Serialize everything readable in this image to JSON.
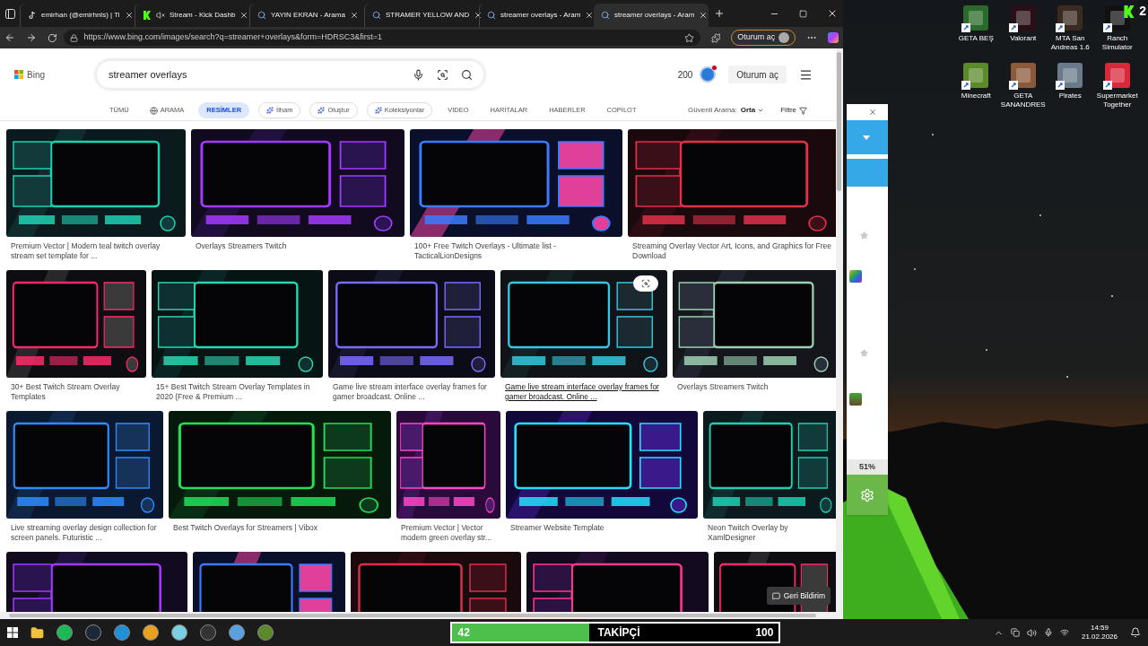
{
  "browser": {
    "tabs": [
      {
        "title": "emirhan (@emirhnls) | Ti",
        "kind": "note",
        "muted": false,
        "selected": false
      },
      {
        "title": "Stream - Kick Dashb",
        "kind": "k",
        "muted": true,
        "selected": false
      },
      {
        "title": "YAYIN EKRAN - Arama",
        "kind": "search",
        "muted": false,
        "selected": false
      },
      {
        "title": "STRAMER YELLOW AND",
        "kind": "search",
        "muted": false,
        "selected": false
      },
      {
        "title": "streamer overlays - Aram",
        "kind": "search",
        "muted": false,
        "selected": false
      },
      {
        "title": "streamer overlays - Aram",
        "kind": "search",
        "muted": false,
        "selected": true
      }
    ],
    "address": "https://www.bing.com/images/search?q=streamer+overlays&form=HDRSC3&first=1",
    "profile_button": "Oturum aç"
  },
  "bing": {
    "logo": "Bing",
    "query": "streamer overlays",
    "points": "200",
    "sign_in": "Oturum aç",
    "nav": [
      {
        "label": "TÜMÜ",
        "kind": "text",
        "selected": false
      },
      {
        "label": "ARAMA",
        "kind": "icon",
        "selected": false
      },
      {
        "label": "RESİMLER",
        "kind": "text",
        "selected": true
      },
      {
        "label": "İlham",
        "kind": "chip",
        "selected": false
      },
      {
        "label": "Oluştur",
        "kind": "chip",
        "selected": false
      },
      {
        "label": "Koleksiyonlar",
        "kind": "chip",
        "selected": false
      },
      {
        "label": "VİDEO",
        "kind": "text",
        "selected": false
      },
      {
        "label": "HARİTALAR",
        "kind": "text",
        "selected": false
      },
      {
        "label": "HABERLER",
        "kind": "text",
        "selected": false
      },
      {
        "label": "COPİLOT",
        "kind": "text",
        "selected": false
      }
    ],
    "safe_search_label": "Güvenli Arama:",
    "safe_search_value": "Orta",
    "filter": "Filtre",
    "rows": [
      [
        {
          "caption": "Premium Vector | Modern teal twitch overlay stream set template for ...",
          "hovered": false
        },
        {
          "caption": "Overlays Streamers Twitch",
          "hovered": false
        },
        {
          "caption": "100+ Free Twitch Overlays - Ultimate list - TacticalLionDesigns",
          "hovered": false
        },
        {
          "caption": "Streaming Overlay Vector Art, Icons, and Graphics for Free Download",
          "hovered": false
        }
      ],
      [
        {
          "caption": "30+ Best Twitch Stream Overlay Templates",
          "hovered": false
        },
        {
          "caption": "15+ Best Twitch Stream Overlay Templates in 2020 (Free & Premium ...",
          "hovered": false
        },
        {
          "caption": "Game live stream interface overlay frames for gamer broadcast. Online ...",
          "hovered": false
        },
        {
          "caption": "Game live stream interface overlay frames for gamer broadcast. Online ...",
          "hovered": true
        },
        {
          "caption": "Overlays Streamers Twitch",
          "hovered": false
        }
      ],
      [
        {
          "caption": "Live streaming overlay design collection for screen panels. Futuristic ...",
          "hovered": false
        },
        {
          "caption": "Best Twitch Overlays for Streamers | Vibox",
          "hovered": false
        },
        {
          "caption": "Premium Vector | Vector modern green overlay str...",
          "hovered": false
        },
        {
          "caption": "Streamer Website Template",
          "hovered": false
        },
        {
          "caption": "Neon Twitch Overlay by XamlDesigner",
          "hovered": false
        }
      ],
      [
        {
          "hovered": false
        },
        {
          "hovered": false
        },
        {
          "hovered": false
        },
        {
          "hovered": false
        },
        {
          "hovered": false
        }
      ]
    ],
    "feedback": "Geri Bildirim"
  },
  "desktop": {
    "corner_badge": "2",
    "icons": [
      {
        "label": "GETA BEŞ"
      },
      {
        "label": "Valorant"
      },
      {
        "label": "MTA San Andreas 1.6"
      },
      {
        "label": "Ranch Simulator"
      },
      {
        "label": "Minecraft"
      },
      {
        "label": "GETA SANANDRES"
      },
      {
        "label": "Pirates"
      },
      {
        "label": "Supermarket Together"
      }
    ]
  },
  "side_window": {
    "percent": "51%"
  },
  "taskbar": {
    "followers": {
      "value": "42",
      "label": "TAKİPÇİ",
      "goal": "100",
      "level": 0.42
    },
    "time": "14:59",
    "date": "21.02.2026"
  }
}
